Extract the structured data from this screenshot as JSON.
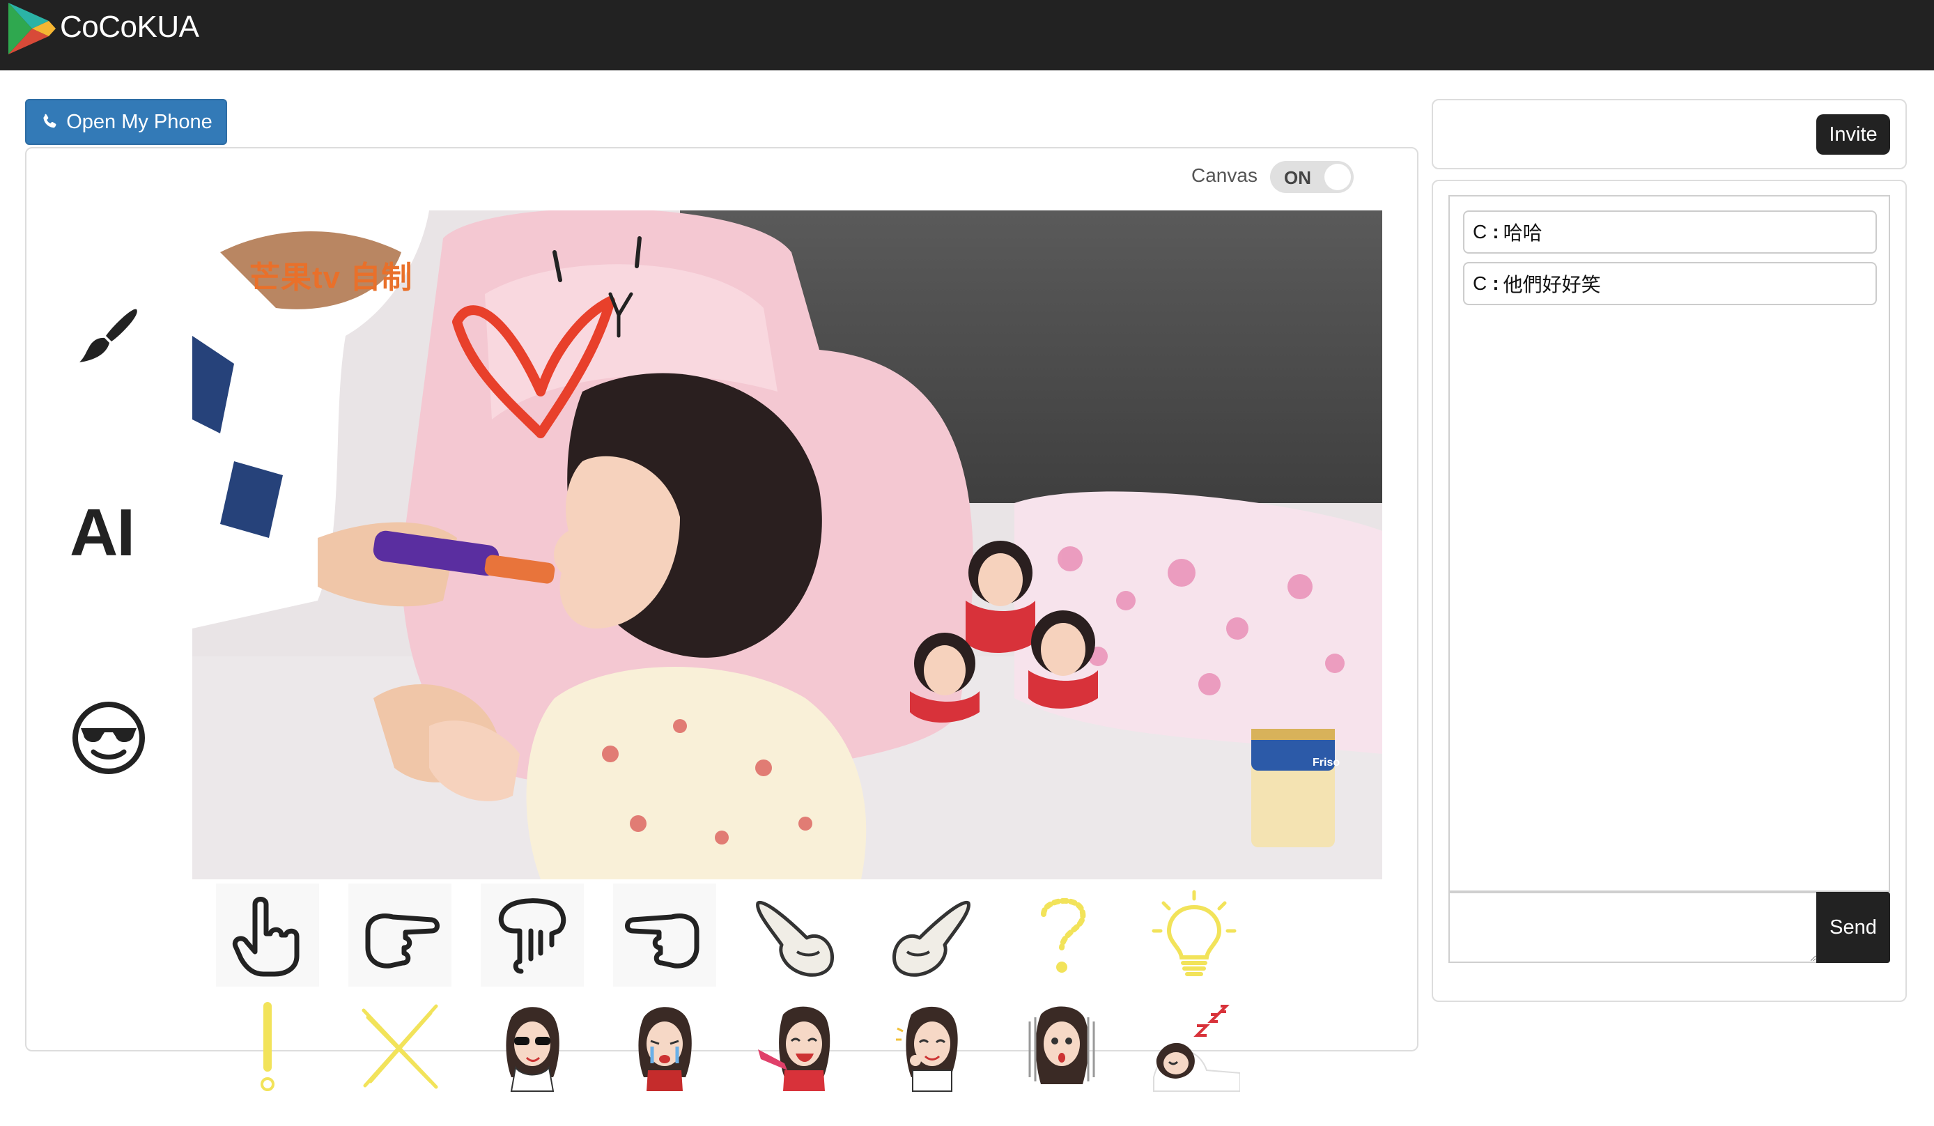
{
  "app": {
    "brand": "CoCoKUA"
  },
  "toolbar": {
    "open_phone_label": "Open My Phone"
  },
  "canvas": {
    "label": "Canvas",
    "toggle_state": "ON"
  },
  "tools": [
    {
      "name": "brush",
      "icon": "paintbrush-icon"
    },
    {
      "name": "ai",
      "label": "AI"
    },
    {
      "name": "emoji",
      "icon": "sunglasses-face-icon"
    }
  ],
  "video": {
    "watermark": "芒果tv 自制",
    "product_label": "Friso"
  },
  "stickers": {
    "row1": [
      "pointing-up-hand-icon",
      "pointing-right-hand-icon",
      "pointing-down-hand-icon",
      "pointing-left-hand-icon",
      "cartoon-glove-pointing-icon",
      "cartoon-glove-pointing-icon",
      "question-mark-icon",
      "lightbulb-icon"
    ],
    "row2": [
      "exclamation-mark-icon",
      "cross-mark-icon",
      "sunglasses-girl-sticker",
      "crying-girl-sticker",
      "laughing-girl-sticker",
      "giggling-girl-sticker",
      "shocked-girl-sticker",
      "sleeping-girl-sticker"
    ]
  },
  "invite": {
    "button_label": "Invite",
    "field_value": ""
  },
  "chat": {
    "messages": [
      {
        "user": "C",
        "text": "哈哈"
      },
      {
        "user": "C",
        "text": "他們好好笑"
      }
    ],
    "send_label": "Send",
    "input_value": ""
  },
  "colors": {
    "navbar": "#222222",
    "primary": "#337ab7",
    "dark_button": "#222222",
    "accent": "#e8402b"
  }
}
